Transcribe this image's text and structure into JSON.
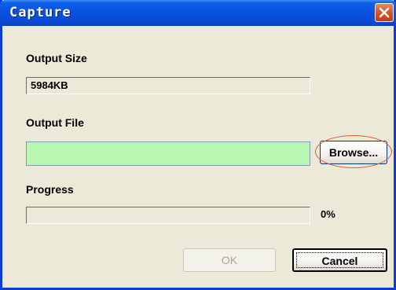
{
  "window": {
    "title": "Capture"
  },
  "output_size": {
    "label": "Output Size",
    "value": "5984KB"
  },
  "output_file": {
    "label": "Output File",
    "value": "",
    "browse_label": "Browse..."
  },
  "progress": {
    "label": "Progress",
    "percent_text": "0%",
    "value": 0
  },
  "buttons": {
    "ok": "OK",
    "cancel": "Cancel"
  },
  "icons": {
    "close": "close-icon"
  },
  "colors": {
    "title_bar": "#0a52df",
    "file_field_bg": "#b7f7b1",
    "highlight_ellipse": "#d9603d",
    "close_button": "#d9532a"
  }
}
